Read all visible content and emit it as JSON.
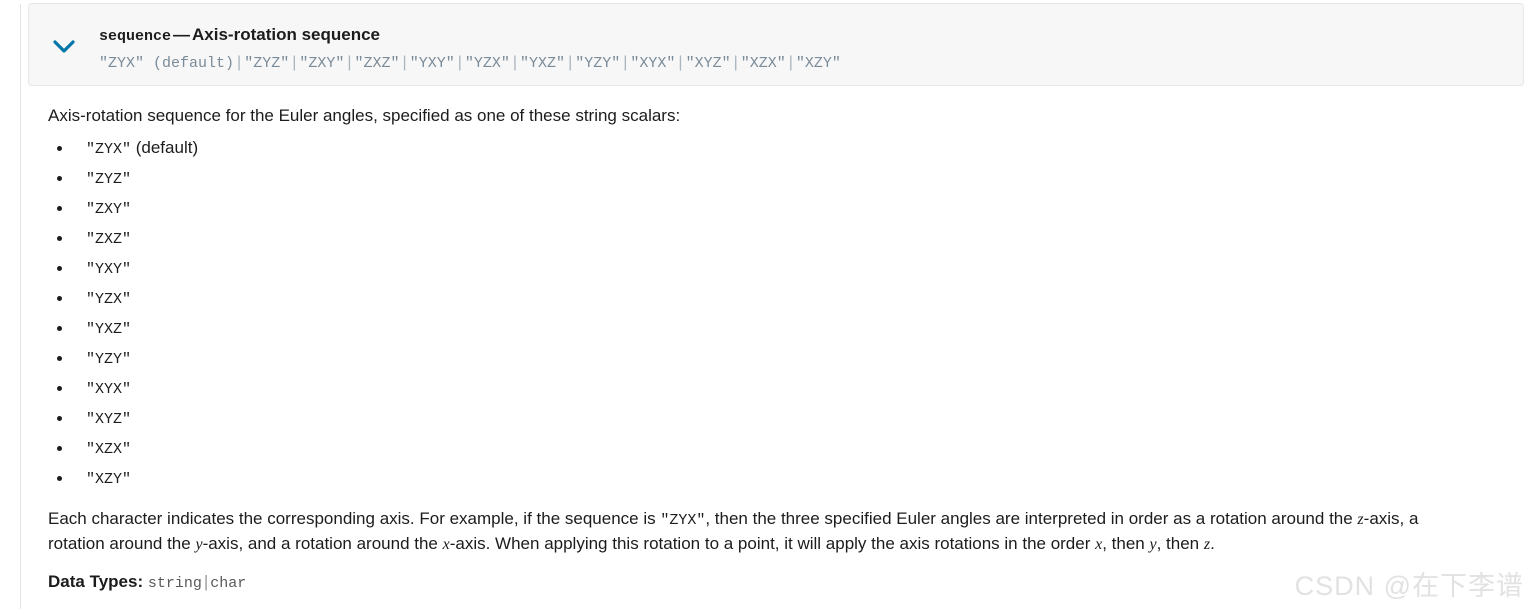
{
  "header": {
    "chevron_icon": "chevron-down-icon",
    "expanded": true,
    "param_name": "sequence",
    "dash": "—",
    "title": "Axis-rotation sequence",
    "options_summary": [
      "\"ZYX\" (default)",
      "\"ZYZ\"",
      "\"ZXY\"",
      "\"ZXZ\"",
      "\"YXY\"",
      "\"YZX\"",
      "\"YXZ\"",
      "\"YZY\"",
      "\"XYX\"",
      "\"XYZ\"",
      "\"XZX\"",
      "\"XZY\""
    ],
    "options_separator": "|",
    "default_suffix": " (default)"
  },
  "body": {
    "intro": "Axis-rotation sequence for the Euler angles, specified as one of these string scalars:",
    "options": [
      {
        "value": "\"ZYX\"",
        "note": " (default)"
      },
      {
        "value": "\"ZYZ\"",
        "note": ""
      },
      {
        "value": "\"ZXY\"",
        "note": ""
      },
      {
        "value": "\"ZXZ\"",
        "note": ""
      },
      {
        "value": "\"YXY\"",
        "note": ""
      },
      {
        "value": "\"YZX\"",
        "note": ""
      },
      {
        "value": "\"YXZ\"",
        "note": ""
      },
      {
        "value": "\"YZY\"",
        "note": ""
      },
      {
        "value": "\"XYX\"",
        "note": ""
      },
      {
        "value": "\"XYZ\"",
        "note": ""
      },
      {
        "value": "\"XZX\"",
        "note": ""
      },
      {
        "value": "\"XZY\"",
        "note": ""
      }
    ],
    "explanation": {
      "t1": "Each character indicates the corresponding axis. For example, if the sequence is ",
      "code1": "\"ZYX\"",
      "t2": ", then the three specified Euler angles are interpreted in order as a rotation around the ",
      "ax1": "z",
      "t3": "-axis, a rotation around the ",
      "ax2": "y",
      "t4": "-axis, and a rotation around the ",
      "ax3": "x",
      "t5": "-axis. When applying this rotation to a point, it will apply the axis rotations in the order ",
      "ax4": "x",
      "t6": ", then ",
      "ax5": "y",
      "t7": ", then ",
      "ax6": "z",
      "t8": "."
    },
    "data_types": {
      "label": "Data Types:",
      "type1": "string",
      "separator": "|",
      "type2": "char"
    }
  },
  "watermark": {
    "text": "CSDN @在下李谱"
  },
  "colors": {
    "header_bg": "#f7f7f7",
    "header_border": "#e6e6e6",
    "chevron": "#0076a8",
    "subtitle_text": "#7a8b99",
    "body_text": "#1c1c1c",
    "mono_muted": "#5a5a5a",
    "watermark": "#e2e2e2"
  }
}
